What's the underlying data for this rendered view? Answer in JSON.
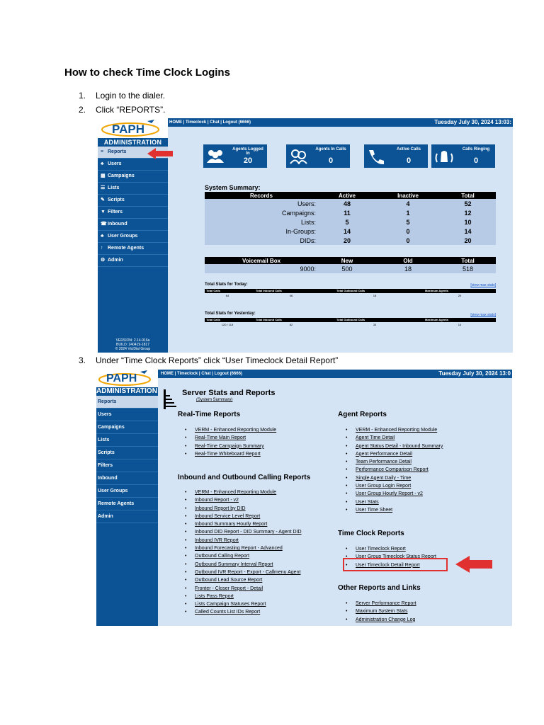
{
  "doc": {
    "title": "How to check Time Clock Logins",
    "steps": [
      {
        "num": "1.",
        "text": "Login to the dialer."
      },
      {
        "num": "2.",
        "text": "Click “REPORTS”."
      },
      {
        "num": "3.",
        "text": "Under “Time Clock Reports” click  “User Timeclock Detail Report”"
      }
    ]
  },
  "brand": {
    "logo": "PAPH",
    "admin_label": "ADMINISTRATION",
    "admin_label_cut": "ADMINISTRATION",
    "primary_color": "#0b5394",
    "highlight_color": "#e03030"
  },
  "shot1": {
    "topbar_links": "HOME | Timeclock | Chat | Logout (6666)",
    "datetime": "Tuesday July 30, 2024 13:03:",
    "nav": [
      {
        "label": "Reports",
        "icon": "≡"
      },
      {
        "label": "Users",
        "icon": "♣"
      },
      {
        "label": "Campaigns",
        "icon": "▦"
      },
      {
        "label": "Lists",
        "icon": "☰"
      },
      {
        "label": "Scripts",
        "icon": "✎"
      },
      {
        "label": "Filters",
        "icon": "▼"
      },
      {
        "label": "Inbound",
        "icon": "☎"
      },
      {
        "label": "User Groups",
        "icon": "♣"
      },
      {
        "label": "Remote Agents",
        "icon": "↑"
      },
      {
        "label": "Admin",
        "icon": "⚙"
      }
    ],
    "version": [
      "VERSION: 2.14-916a",
      "BUILD: 240419-1817",
      "© 2024 ViciDial Group"
    ],
    "tiles": [
      {
        "label": "Agents Logged In",
        "value": "20",
        "icon": "users-icon"
      },
      {
        "label": "Agents In Calls",
        "value": "0",
        "icon": "agents-icon"
      },
      {
        "label": "Active Calls",
        "value": "0",
        "icon": "phone-icon"
      },
      {
        "label": "Calls Ringing",
        "value": "0",
        "icon": "ringing-icon"
      }
    ],
    "summary_title": "System Summary:",
    "summary_headers": [
      "Records",
      "Active",
      "Inactive",
      "Total"
    ],
    "summary_rows": [
      [
        "Users:",
        "48",
        "4",
        "52"
      ],
      [
        "Campaigns:",
        "11",
        "1",
        "12"
      ],
      [
        "Lists:",
        "5",
        "5",
        "10"
      ],
      [
        "In-Groups:",
        "14",
        "0",
        "14"
      ],
      [
        "DIDs:",
        "20",
        "0",
        "20"
      ]
    ],
    "vm_headers": [
      "Voicemail Box",
      "New",
      "Old",
      "Total"
    ],
    "vm_row": [
      "9000:",
      "500",
      "18",
      "518"
    ],
    "today_title": "Total Stats for Today:",
    "yesterday_title": "Total Stats for Yesterday:",
    "max_link": "[view max stats]",
    "stats_headers": [
      "Total Calls",
      "Total Inbound Calls",
      "Total Outbound Calls",
      "Maximum Agents"
    ],
    "today_values": [
      "64",
      "46",
      "18",
      "20"
    ],
    "yesterday_values": [
      "120 / 115",
      "82",
      "33",
      "14"
    ]
  },
  "shot2": {
    "topbar_links": "HOME | Timeclock | Chat | Logout (6666)",
    "datetime": "Tuesday July 30, 2024 13:0",
    "nav": [
      "Reports",
      "Users",
      "Campaigns",
      "Lists",
      "Scripts",
      "Filters",
      "Inbound",
      "User Groups",
      "Remote Agents",
      "Admin"
    ],
    "title": "Server Stats and Reports",
    "subtitle": "(System Summary)",
    "realtime_title": "Real-Time Reports",
    "realtime": [
      "VERM - Enhanced Reporting Module",
      "Real-Time Main Report",
      "Real-Time Campaign Summary",
      "Real-Time Whiteboard Report"
    ],
    "inout_title": "Inbound and Outbound Calling Reports",
    "inout": [
      "VERM - Enhanced Reporting Module",
      "Inbound Report - v2",
      "Inbound Report by DID",
      "Inbound Service Level Report",
      "Inbound Summary Hourly Report",
      "Inbound DID Report - DID Summary - Agent DID",
      "Inbound IVR Report",
      "Inbound Forecasting Report - Advanced",
      "Outbound Calling Report",
      "Outbound Summary Interval Report",
      "Outbound IVR Report - Export - Callmenu Agent",
      "Outbound Lead Source Report",
      "Fronter - Closer Report - Detail",
      "Lists Pass Report",
      "Lists Campaign Statuses Report",
      "Called Counts List IDs Report"
    ],
    "agent_title": "Agent Reports",
    "agent": [
      "VERM - Enhanced Reporting Module",
      "Agent Time Detail",
      "Agent Status Detail - Inbound Summary",
      "Agent Performance Detail",
      "Team Performance Detail",
      "Performance Comparison Report",
      "Single Agent Daily - Time",
      "User Group Login Report",
      "User Group Hourly Report - v2",
      "User Stats",
      "User Time Sheet"
    ],
    "timeclock_title": "Time Clock Reports",
    "timeclock": [
      "User Timeclock Report",
      "User Group Timeclock Status Report",
      "User Timeclock Detail Report"
    ],
    "other_title": "Other Reports and Links",
    "other": [
      "Server Performance Report",
      "Maximum System Stats",
      "Administration Change Log"
    ]
  }
}
